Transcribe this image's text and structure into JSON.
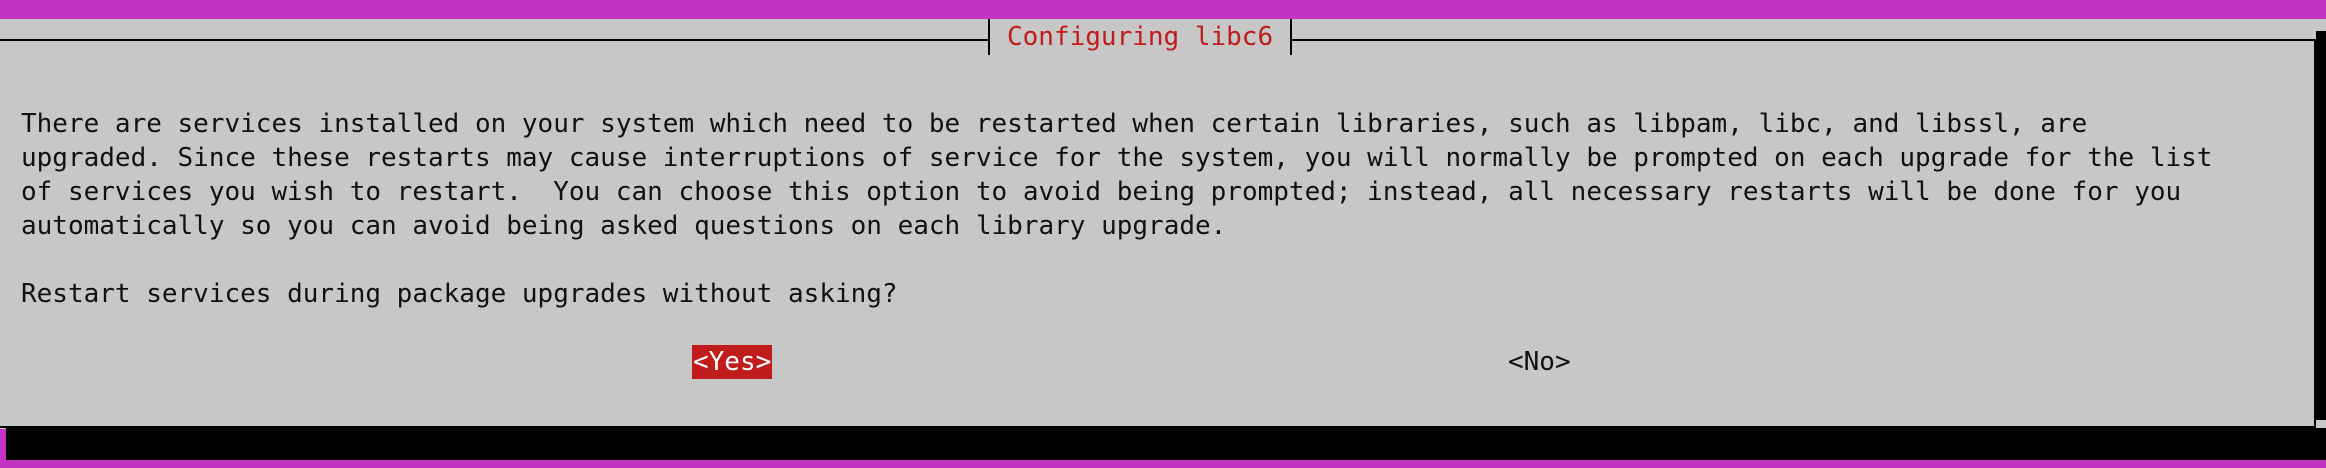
{
  "dialog": {
    "title": "Configuring libc6",
    "message": "There are services installed on your system which need to be restarted when certain libraries, such as libpam, libc, and libssl, are\nupgraded. Since these restarts may cause interruptions of service for the system, you will normally be prompted on each upgrade for the list\nof services you wish to restart.  You can choose this option to avoid being prompted; instead, all necessary restarts will be done for you\nautomatically so you can avoid being asked questions on each library upgrade.",
    "question": "Restart services during package upgrades without asking?",
    "buttons": {
      "yes": "<Yes>",
      "no": "<No>"
    },
    "selected_button": "yes"
  },
  "colors": {
    "terminal_background": "#c233c2",
    "dialog_background": "#c7c7c7",
    "title_text": "#c01c1c",
    "selected_button_background": "#c01c1c",
    "selected_button_text": "#ffffff",
    "shadow": "#000000"
  }
}
